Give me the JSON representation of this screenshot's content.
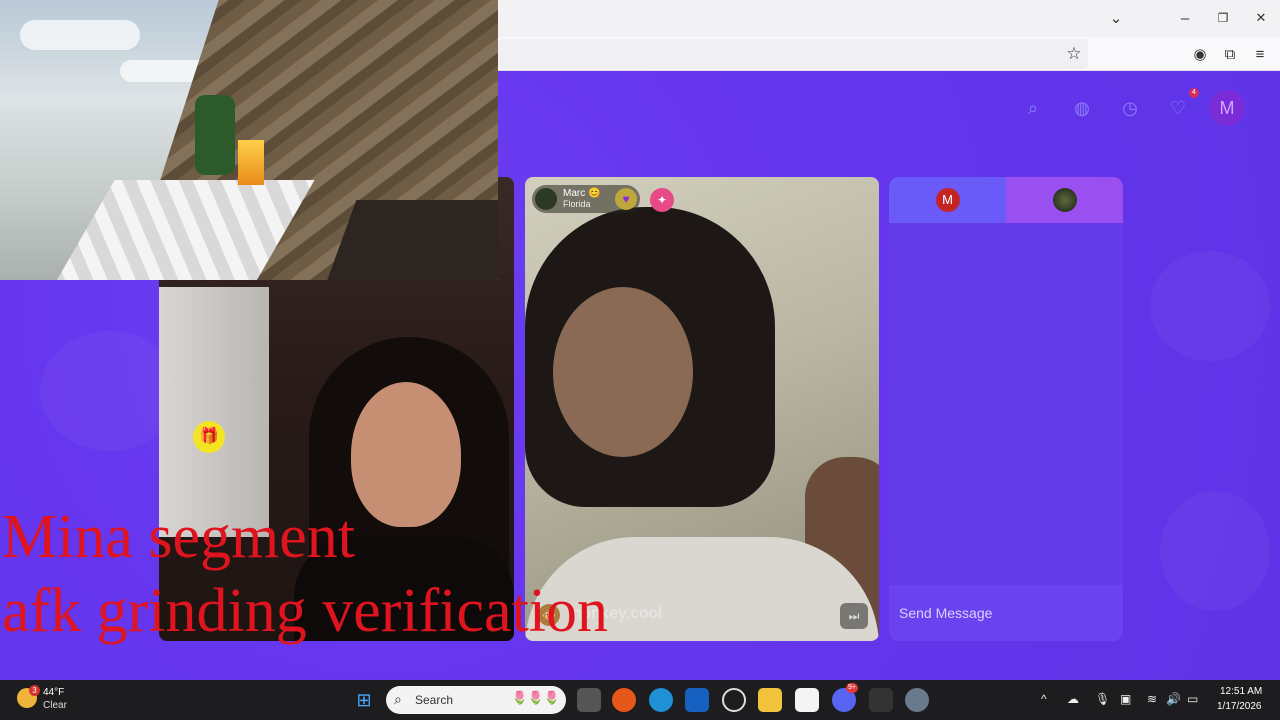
{
  "browser": {
    "icons": [
      "chevron-down-icon",
      "minimize-icon",
      "restore-icon",
      "close-icon",
      "star-icon",
      "account-icon",
      "extensions-icon",
      "menu-icon"
    ],
    "minimize_glyph": "–",
    "restore_glyph": "❐",
    "close_glyph": "✕",
    "chevron_glyph": "⌄",
    "star_glyph": "☆",
    "account_glyph": "◉",
    "extensions_glyph": "⧉",
    "menu_glyph": "≡"
  },
  "site": {
    "nav": {
      "search_glyph": "⌕",
      "coin_glyph": "◍",
      "history_glyph": "◷",
      "messages_glyph": "♡",
      "messages_badge": "4",
      "avatar_letter": "M"
    },
    "remote_user": {
      "name": "Marc 😊",
      "location": "Florida",
      "heart_glyph": "♥",
      "badge_glyph": "✦"
    },
    "stream_handle": "monkey.cool",
    "monkey_glyph": "🐵",
    "skip_glyph": "⏭",
    "chat": {
      "tab_me_letter": "M",
      "input_placeholder": "Send Message",
      "gift_glyph": "🎁"
    }
  },
  "overlay": {
    "caption_line1": "Mina segment",
    "caption_line2": "afk grinding verification"
  },
  "taskbar": {
    "weather_temp": "44°F",
    "weather_condition": "Clear",
    "weather_badge": "3",
    "search_label": "Search",
    "search_glyph": "⌕",
    "search_decor": "🌷🌷🌷",
    "pinned": [
      "windows-start-icon",
      "task-view-icon",
      "firefox-icon",
      "edge-icon",
      "outlook-icon",
      "chatgpt-icon",
      "file-explorer-icon",
      "store-icon",
      "discord-icon",
      "app-icon",
      "settings-icon"
    ],
    "discord_badge": "9+",
    "tray_chevron": "^",
    "time": "12:51 AM",
    "date": "1/17/2026"
  }
}
